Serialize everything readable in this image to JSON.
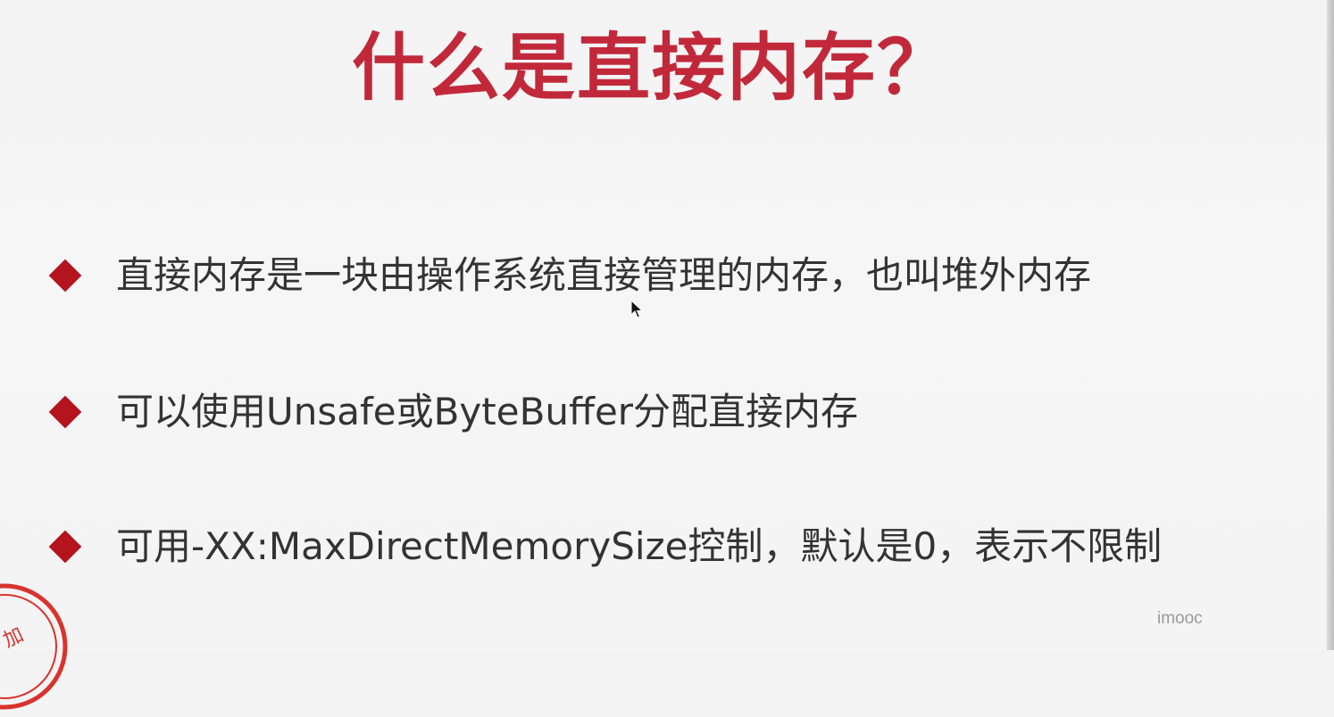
{
  "slide": {
    "title": "什么是直接内存？",
    "bullets": [
      "直接内存是一块由操作系统直接管理的内存，也叫堆外内存",
      "可以使用Unsafe或ByteBuffer分配直接内存",
      "可用-XX:MaxDirectMemorySize控制，默认是0，表示不限制"
    ],
    "watermark": "imooc",
    "stamp_text": "加"
  },
  "colors": {
    "title": "#c1293b",
    "bullet_marker": "#b3141e",
    "body_text": "#333333",
    "stamp": "#d9332e",
    "background": "#f4f4f4"
  },
  "icons": {
    "bullet_marker": "diamond-icon",
    "pointer": "mouse-pointer-icon",
    "stamp": "seal-stamp-icon"
  }
}
